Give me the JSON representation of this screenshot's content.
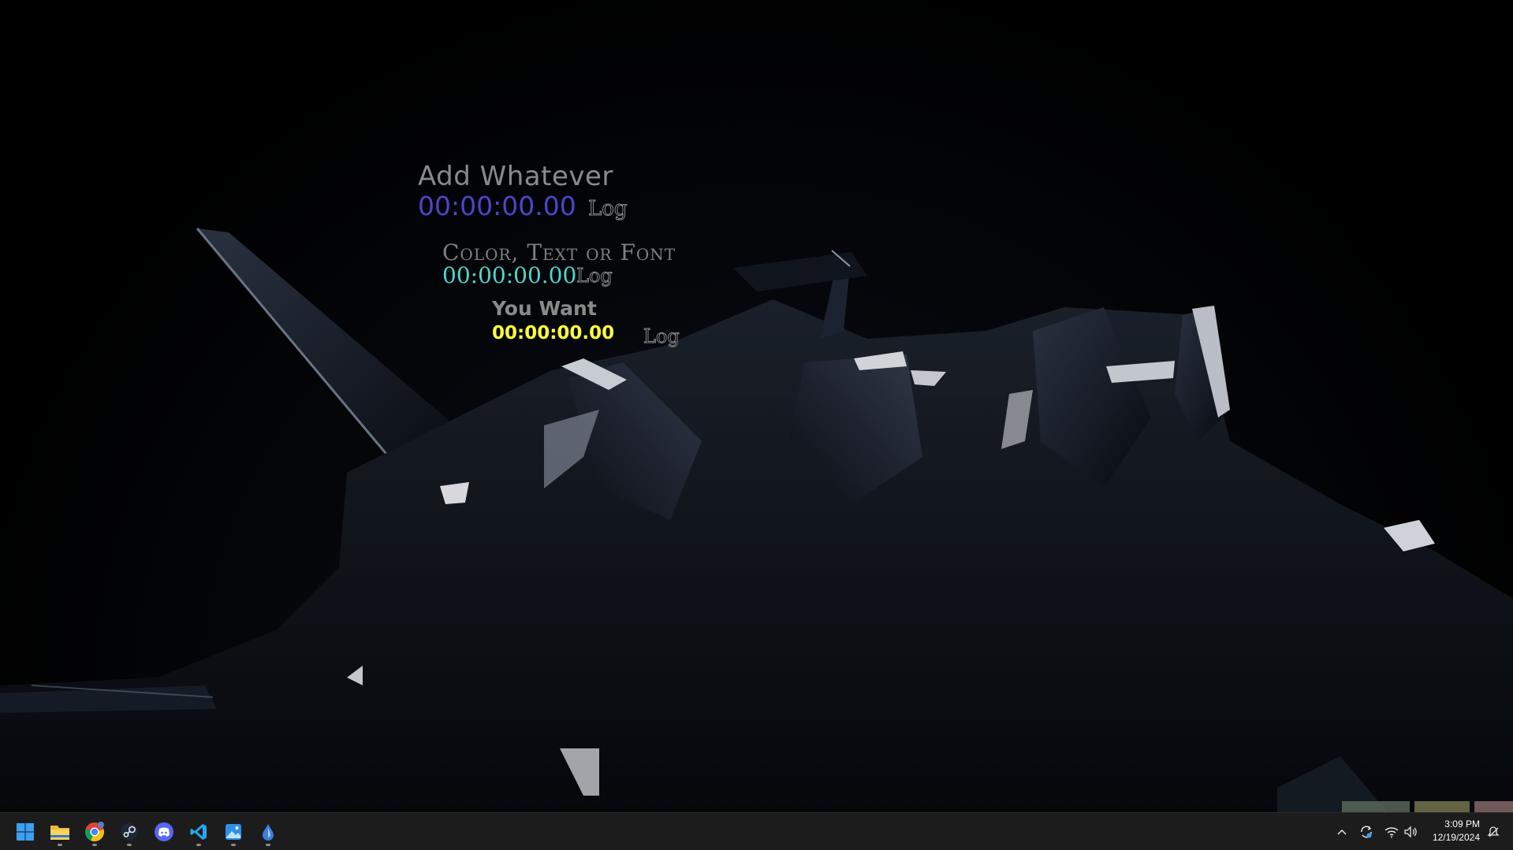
{
  "widgets": [
    {
      "title": "Add Whatever",
      "time": "00:00:00.00",
      "log": "Log"
    },
    {
      "title": "Color, Text or Font",
      "time": "00:00:00.00",
      "log": "Log"
    },
    {
      "title": "You Want",
      "time": "00:00:00.00",
      "log": "Log"
    }
  ],
  "taskbar": {
    "apps": [
      {
        "name": "start",
        "icon": "windows-start-icon"
      },
      {
        "name": "file-explorer",
        "icon": "folder-icon"
      },
      {
        "name": "chrome",
        "icon": "chrome-icon"
      },
      {
        "name": "steam",
        "icon": "steam-icon"
      },
      {
        "name": "discord",
        "icon": "discord-icon"
      },
      {
        "name": "vscode",
        "icon": "vscode-icon"
      },
      {
        "name": "photos",
        "icon": "photos-icon"
      },
      {
        "name": "droplet-app",
        "icon": "droplet-icon"
      }
    ],
    "tray": [
      "chevron-up-icon",
      "sync-icon",
      "wifi-icon",
      "volume-icon",
      "notification-icon"
    ],
    "clock": {
      "time": "3:09 PM",
      "date": "12/19/2024"
    }
  },
  "colors": {
    "widget1_time": "#4b46c9",
    "widget2_time": "#4fd6cc",
    "widget3_time": "#ffff3c",
    "title_gray": "#8a8a8a",
    "taskbar_bg": "#1c1c1c"
  }
}
